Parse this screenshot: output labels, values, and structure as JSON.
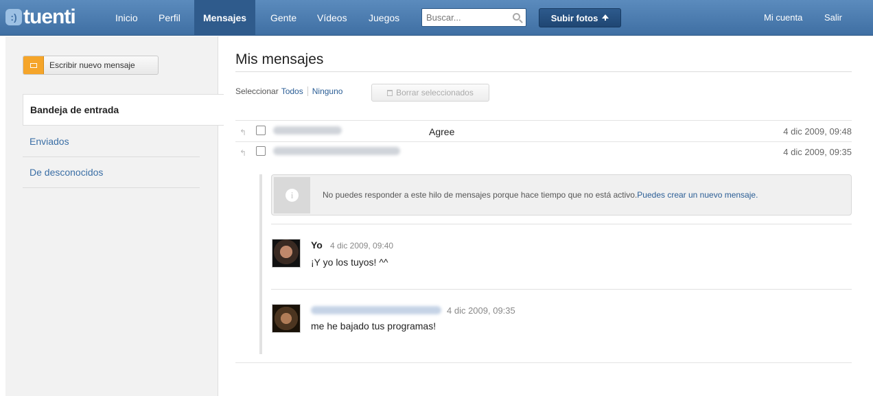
{
  "topbar": {
    "logo": "tuenti",
    "logo_badge": ":)",
    "nav": [
      "Inicio",
      "Perfil",
      "Mensajes",
      "Gente",
      "Vídeos",
      "Juegos"
    ],
    "search_placeholder": "Buscar...",
    "upload_label": "Subir fotos",
    "account": "Mi cuenta",
    "logout": "Salir"
  },
  "sidebar": {
    "compose_label": "Escribir nuevo mensaje",
    "items": [
      "Bandeja de entrada",
      "Enviados",
      "De desconocidos"
    ],
    "active_item": "Bandeja de entrada"
  },
  "main": {
    "title": "Mis mensajes",
    "select_label": "Seleccionar",
    "select_all": "Todos",
    "select_none": "Ninguno",
    "delete_label": "Borrar seleccionados",
    "messages": [
      {
        "subject": "Agree",
        "date": "4 dic 2009, 09:48"
      },
      {
        "subject": "",
        "date": "4 dic 2009, 09:35"
      }
    ],
    "notice_text": "No puedes responder a este hilo de mensajes porque hace tiempo que no está activo.",
    "notice_link": "Puedes crear un nuevo mensaje.",
    "posts": [
      {
        "author": "Yo",
        "date": "4 dic 2009, 09:40",
        "text": "¡Y yo los tuyos! ^^"
      },
      {
        "author": "",
        "date": "4 dic 2009, 09:35",
        "text": "me he bajado tus programas!"
      }
    ]
  },
  "colors": {
    "topbar": "#4a7cb0",
    "accent_orange": "#f5a52a",
    "link": "#2a5d95"
  }
}
